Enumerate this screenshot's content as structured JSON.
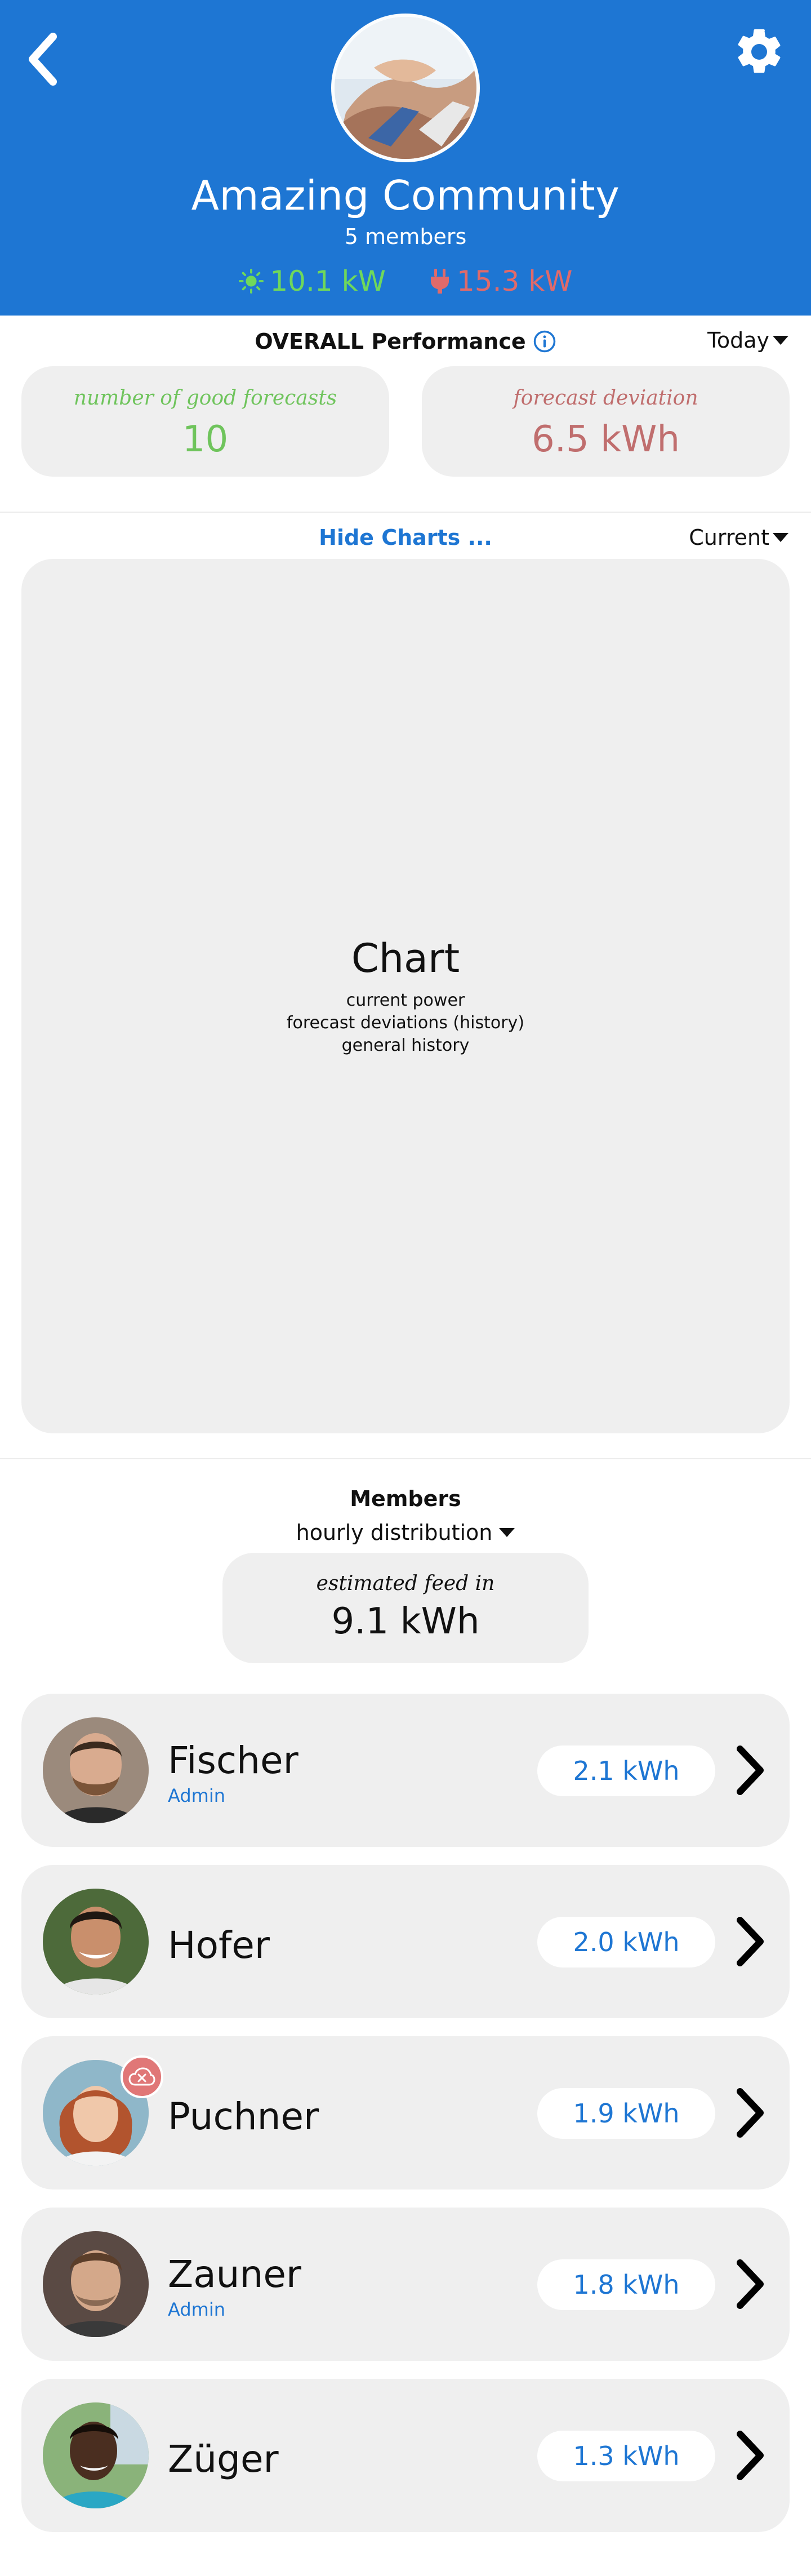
{
  "header": {
    "title": "Amazing Community",
    "members_count": "5 members",
    "production": "10.1 kW",
    "consumption": "15.3 kW",
    "brand_color": "#1e76d3"
  },
  "performance": {
    "heading": "OVERALL Performance",
    "period": "Today",
    "cards": [
      {
        "caption": "number of good forecasts",
        "value": "10"
      },
      {
        "caption": "forecast deviation",
        "value": "6.5 kWh"
      }
    ]
  },
  "charts": {
    "toggle_label": "Hide Charts ...",
    "view": "Current",
    "placeholder_title": "Chart",
    "placeholder_lines": [
      "current power",
      "forecast deviations (history)",
      "general history"
    ]
  },
  "members": {
    "heading": "Members",
    "distribution": "hourly distribution",
    "feed": {
      "caption": "estimated feed in",
      "value": "9.1 kWh"
    },
    "list": [
      {
        "name": "Fischer",
        "role": "Admin",
        "value": "2.1 kWh"
      },
      {
        "name": "Hofer",
        "role": "",
        "value": "2.0 kWh"
      },
      {
        "name": "Puchner",
        "role": "",
        "value": "1.9 kWh"
      },
      {
        "name": "Zauner",
        "role": "Admin",
        "value": "1.8 kWh"
      },
      {
        "name": "Züger",
        "role": "",
        "value": "1.3 kWh"
      }
    ]
  }
}
